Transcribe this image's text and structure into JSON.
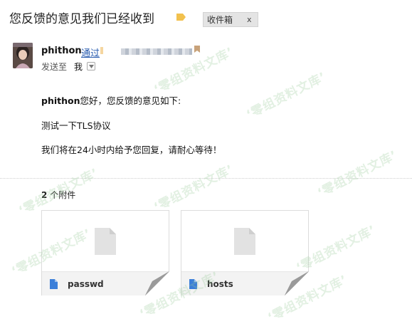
{
  "mail": {
    "subject": "您反馈的意见我们已经收到",
    "folder_tag": "收件箱",
    "folder_tag_close": "x"
  },
  "sender": {
    "name": "phithon",
    "via": "通过",
    "to_label": "发送至",
    "to_value": "我"
  },
  "body": {
    "line1_name": "phithon",
    "line1_rest": "您好，您反馈的意见如下:",
    "line2": "测试一下TLS协议",
    "line3": "我们将在24小时内给予您回复，请耐心等待！"
  },
  "attachments": {
    "count": "2",
    "label": "个附件",
    "files": [
      {
        "name": "passwd",
        "icon": "document-icon"
      },
      {
        "name": "hosts",
        "icon": "document-icon"
      }
    ]
  },
  "watermark": {
    "text": "‘零组资料文库’",
    "color": "#96c896"
  },
  "colors": {
    "link": "#2a5db0",
    "tag_icon": "#f2c14e",
    "file_icon": "#3b7fd9"
  }
}
